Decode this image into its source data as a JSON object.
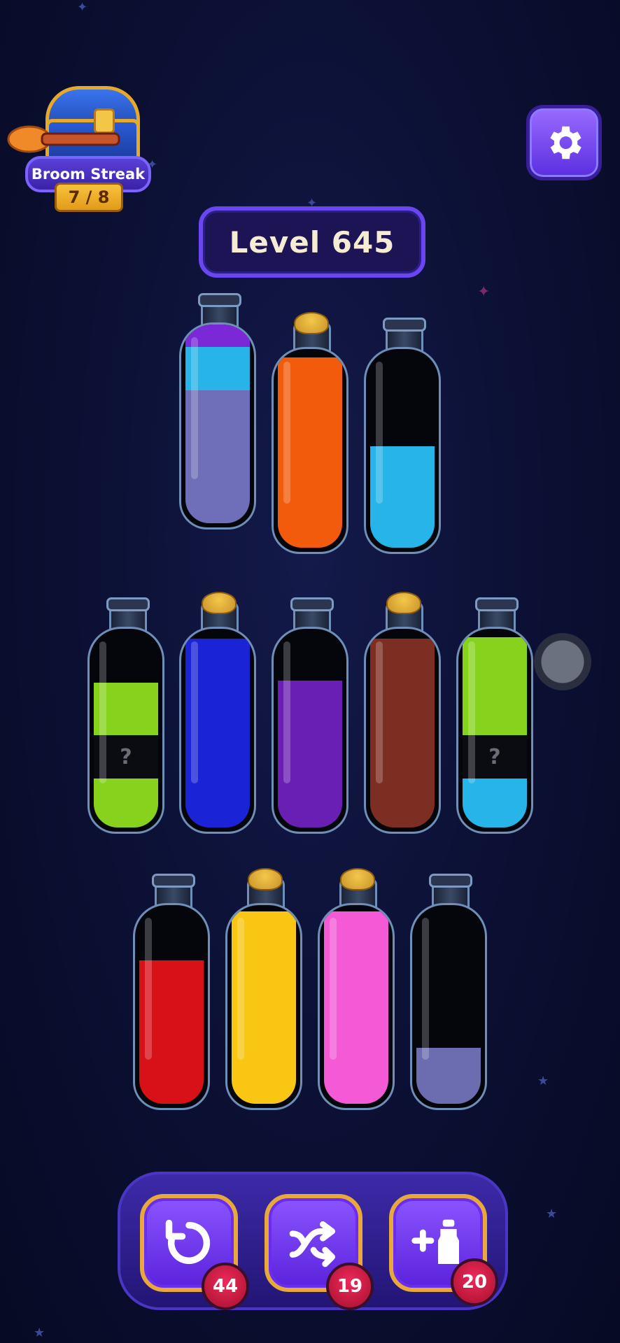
{
  "streak": {
    "title": "Broom Streak",
    "progress": "7 / 8"
  },
  "level": {
    "label": "Level 645"
  },
  "colors": {
    "purple": "#7a28d8",
    "sky": "#27b4e8",
    "lavender": "#6e6fb8",
    "orange": "#f25a0c",
    "lime": "#86d21c",
    "blue": "#1a24d6",
    "violet": "#6a1fb4",
    "brown": "#7c2e22",
    "red": "#d81018",
    "yellow": "#f8c613",
    "pink": "#f45ad6",
    "periwinkle": "#6b6db0"
  },
  "bottles": [
    {
      "row": 1,
      "corked": false,
      "layers": [
        "lavender",
        "sky",
        "purple"
      ]
    },
    {
      "row": 1,
      "corked": true,
      "layers": [
        "orange"
      ]
    },
    {
      "row": 1,
      "corked": false,
      "layers": [
        "sky"
      ]
    },
    {
      "row": 2,
      "corked": false,
      "layers": [
        "lime",
        "mystery",
        "lime"
      ]
    },
    {
      "row": 2,
      "corked": true,
      "layers": [
        "blue"
      ]
    },
    {
      "row": 2,
      "corked": false,
      "layers": [
        "violet"
      ]
    },
    {
      "row": 2,
      "corked": true,
      "layers": [
        "brown"
      ]
    },
    {
      "row": 2,
      "corked": false,
      "layers": [
        "sky",
        "mystery",
        "lime"
      ]
    },
    {
      "row": 3,
      "corked": false,
      "layers": [
        "red"
      ]
    },
    {
      "row": 3,
      "corked": true,
      "layers": [
        "yellow"
      ]
    },
    {
      "row": 3,
      "corked": true,
      "layers": [
        "pink"
      ]
    },
    {
      "row": 3,
      "corked": false,
      "layers": [
        "periwinkle"
      ]
    }
  ],
  "mystery_symbol": "?",
  "powerups": {
    "undo": {
      "icon": "undo-icon",
      "count": "44"
    },
    "shuffle": {
      "icon": "shuffle-icon",
      "count": "19"
    },
    "add_bottle": {
      "icon": "add-bottle-icon",
      "count": "20"
    }
  }
}
